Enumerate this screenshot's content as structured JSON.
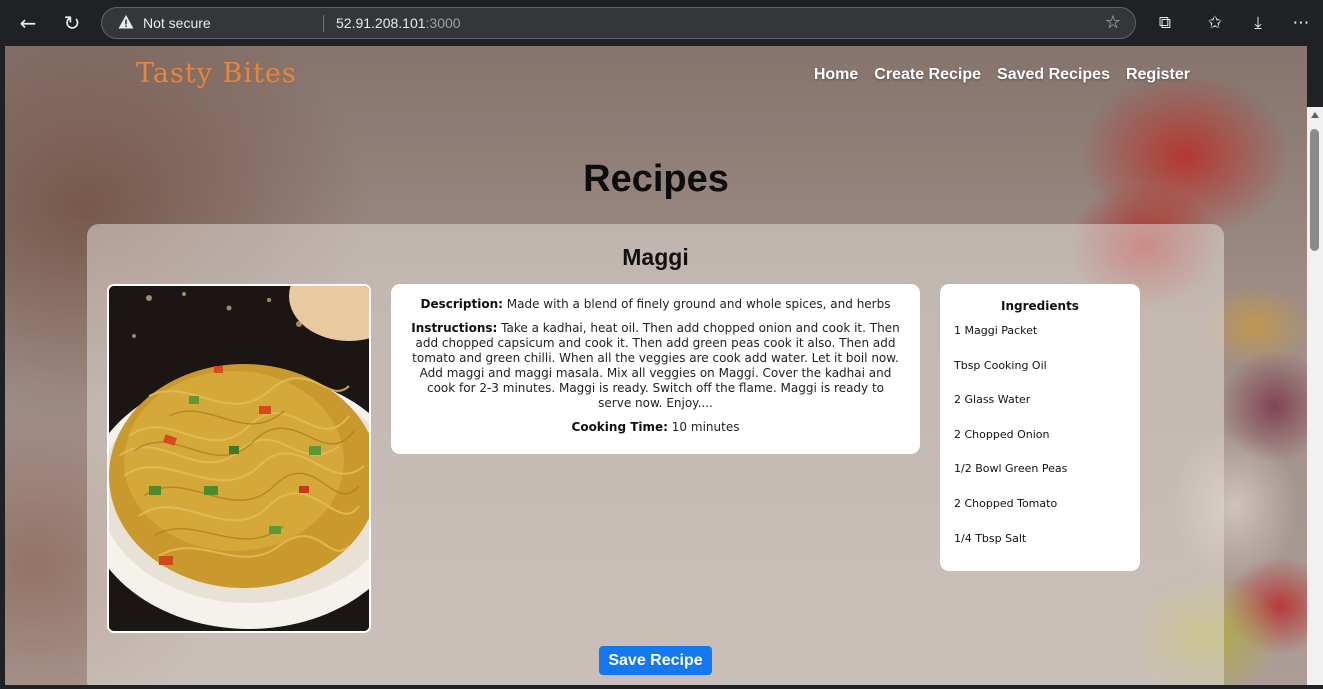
{
  "browser": {
    "security_label": "Not secure",
    "url_host": "52.91.208.101",
    "url_port": ":3000"
  },
  "site": {
    "brand": "Tasty Bites",
    "nav": [
      "Home",
      "Create Recipe",
      "Saved Recipes",
      "Register"
    ]
  },
  "page": {
    "title": "Recipes"
  },
  "recipe": {
    "name": "Maggi",
    "description_label": "Description:",
    "description": "Made with a blend of finely ground and whole spices, and herbs",
    "instructions_label": "Instructions:",
    "instructions": "Take a kadhai, heat oil. Then add chopped onion and cook it. Then add chopped capsicum and cook it. Then add green peas cook it also. Then add tomato and green chilli. When all the veggies are cook add water. Let it boil now. Add maggi and maggi masala. Mix all veggies on Maggi. Cover the kadhai and cook for 2-3 minutes. Maggi is ready. Switch off the flame. Maggi is ready to serve now. Enjoy....",
    "cooking_time_label": "Cooking Time:",
    "cooking_time": "10 minutes",
    "ingredients_title": "Ingredients",
    "ingredients": [
      "1 Maggi Packet",
      "Tbsp Cooking Oil",
      "2 Glass Water",
      "2 Chopped Onion",
      "1/2 Bowl Green Peas",
      "2 Chopped Tomato",
      "1/4 Tbsp Salt"
    ],
    "save_label": "Save Recipe"
  },
  "colors": {
    "brand": "#e8853a",
    "save_button": "#1478f0"
  }
}
